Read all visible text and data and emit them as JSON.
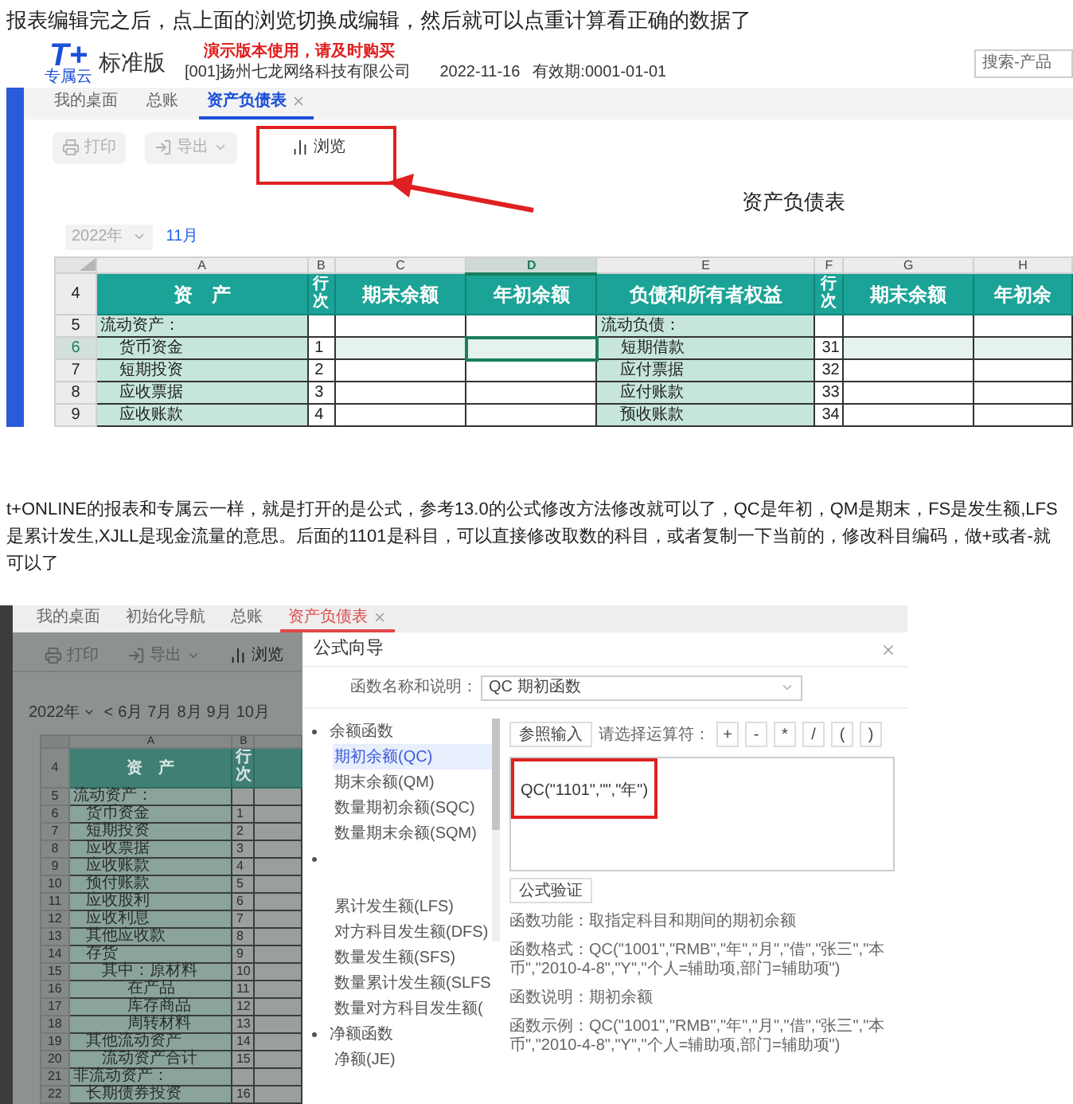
{
  "intro": "报表编辑完之后，点上面的浏览切换成编辑，然后就可以点重计算看正确的数据了",
  "screenshot_1": {
    "logo": {
      "mark": "T+",
      "tagline": "专属云",
      "edition": "标准版"
    },
    "notice": "演示版本使用，请及时购买",
    "company": "[001]扬州七龙网络科技有限公司",
    "date": "2022-11-16",
    "validity": "有效期:0001-01-01",
    "search": {
      "placeholder": "搜索-产品"
    },
    "tabs": [
      {
        "label": "我的桌面",
        "selected": false,
        "closable": false
      },
      {
        "label": "总账",
        "selected": false,
        "closable": false
      },
      {
        "label": "资产负债表",
        "selected": true,
        "closable": true
      }
    ],
    "toolbar": [
      {
        "kind": "print",
        "label": "打印",
        "disabled": true,
        "annotated": false
      },
      {
        "kind": "export",
        "label": "导出",
        "disabled": true,
        "annotated": false
      },
      {
        "kind": "browse",
        "label": "浏览",
        "disabled": false,
        "annotated": true
      }
    ],
    "report_title": "资产负债表",
    "year": "2022年",
    "month": "11月",
    "sheet": {
      "column_letters": [
        {
          "label": "A",
          "selected": false
        },
        {
          "label": "B",
          "selected": false
        },
        {
          "label": "C",
          "selected": false
        },
        {
          "label": "D",
          "selected": true
        },
        {
          "label": "E",
          "selected": false
        },
        {
          "label": "F",
          "selected": false
        },
        {
          "label": "G",
          "selected": false
        },
        {
          "label": "H",
          "selected": false
        }
      ],
      "header_row": {
        "number": "4",
        "cells": [
          "资　产",
          "行次",
          "期末余额",
          "年初余额",
          "负债和所有者权益",
          "行次",
          "期末余额",
          "年初余"
        ]
      },
      "rows": [
        {
          "number": "5",
          "selected": false,
          "asset": {
            "label": "流动资产：",
            "kind": "heading"
          },
          "liability": {
            "label": "流动负债：",
            "kind": "heading"
          }
        },
        {
          "number": "6",
          "selected": true,
          "asset": {
            "label": "货币资金",
            "kind": "item",
            "line": "1"
          },
          "liability": {
            "label": "短期借款",
            "kind": "item",
            "line": "31"
          }
        },
        {
          "number": "7",
          "selected": false,
          "asset": {
            "label": "短期投资",
            "kind": "item",
            "line": "2"
          },
          "liability": {
            "label": "应付票据",
            "kind": "item",
            "line": "32"
          }
        },
        {
          "number": "8",
          "selected": false,
          "asset": {
            "label": "应收票据",
            "kind": "item",
            "line": "3"
          },
          "liability": {
            "label": "应付账款",
            "kind": "item",
            "line": "33"
          }
        },
        {
          "number": "9",
          "selected": false,
          "asset": {
            "label": "应收账款",
            "kind": "item",
            "line": "4"
          },
          "liability": {
            "label": "预收账款",
            "kind": "item",
            "line": "34"
          }
        }
      ]
    }
  },
  "paragraph": "t+ONLINE的报表和专属云一样，就是打开的是公式，参考13.0的公式修改方法修改就可以了，QC是年初，QM是期末，FS是发生额,LFS是累计发生,XJLL是现金流量的意思。后面的1101是科目，可以直接修改取数的科目，或者复制一下当前的，修改科目编码，做+或者-就可以了",
  "screenshot_2": {
    "tabs": [
      {
        "label": "我的桌面",
        "selected": false,
        "closable": false
      },
      {
        "label": "初始化导航",
        "selected": false,
        "closable": false
      },
      {
        "label": "总账",
        "selected": false,
        "closable": false
      },
      {
        "label": "资产负债表",
        "selected": true,
        "closable": true
      }
    ],
    "toolbar": [
      {
        "kind": "print",
        "label": "打印",
        "disabled": true,
        "annotated": false
      },
      {
        "kind": "export",
        "label": "导出",
        "disabled": true,
        "annotated": false
      },
      {
        "kind": "browse",
        "label": "浏览",
        "disabled": false,
        "annotated": false
      }
    ],
    "year": "2022年",
    "prev": "<",
    "months": [
      "6月",
      "7月",
      "8月",
      "9月",
      "10月"
    ],
    "sheet": {
      "column_letters": [
        "A",
        "B"
      ],
      "header_row": {
        "number": "4",
        "cells": [
          "资　产",
          "行次"
        ]
      },
      "rows": [
        {
          "number": "5",
          "label": "流动资产：",
          "kind": "heading"
        },
        {
          "number": "6",
          "label": "货币资金",
          "kind": "item",
          "line": "1"
        },
        {
          "number": "7",
          "label": "短期投资",
          "kind": "item",
          "line": "2"
        },
        {
          "number": "8",
          "label": "应收票据",
          "kind": "item",
          "line": "3"
        },
        {
          "number": "9",
          "label": "应收账款",
          "kind": "item",
          "line": "4"
        },
        {
          "number": "10",
          "label": "预付账款",
          "kind": "item",
          "line": "5"
        },
        {
          "number": "11",
          "label": "应收股利",
          "kind": "item",
          "line": "6"
        },
        {
          "number": "12",
          "label": "应收利息",
          "kind": "item",
          "line": "7"
        },
        {
          "number": "13",
          "label": "其他应收款",
          "kind": "item",
          "line": "8"
        },
        {
          "number": "14",
          "label": "存货",
          "kind": "item",
          "line": "9"
        },
        {
          "number": "15",
          "label": "其中：原材料",
          "kind": "sub",
          "line": "10"
        },
        {
          "number": "16",
          "label": "在产品",
          "kind": "subsub",
          "line": "11"
        },
        {
          "number": "17",
          "label": "库存商品",
          "kind": "subsub",
          "line": "12"
        },
        {
          "number": "18",
          "label": "周转材料",
          "kind": "subsub",
          "line": "13"
        },
        {
          "number": "19",
          "label": "其他流动资产",
          "kind": "item",
          "line": "14"
        },
        {
          "number": "20",
          "label": "流动资产合计",
          "kind": "sub",
          "line": "15"
        },
        {
          "number": "21",
          "label": "非流动资产：",
          "kind": "heading"
        },
        {
          "number": "22",
          "label": "长期债券投资",
          "kind": "item",
          "line": "16"
        }
      ]
    },
    "dialog": {
      "title": "公式向导",
      "function_label": "函数名称和说明：",
      "function_value": "QC 期初函数",
      "tree": [
        {
          "label": "余额函数",
          "children": [
            {
              "label": "期初余额(QC)",
              "selected": true
            },
            {
              "label": "期末余额(QM)",
              "selected": false
            },
            {
              "label": "数量期初余额(SQC)",
              "selected": false
            },
            {
              "label": "数量期末余额(SQM)",
              "selected": false
            }
          ]
        },
        {
          "children": [
            {
              "label": "累计发生额(LFS)",
              "selected": false
            },
            {
              "label": "对方科目发生额(DFS)",
              "selected": false
            },
            {
              "label": "数量发生额(SFS)",
              "selected": false
            },
            {
              "label": "数量累计发生额(SLFS",
              "selected": false
            },
            {
              "label": "数量对方科目发生额(",
              "selected": false
            }
          ]
        },
        {
          "label": "净额函数",
          "children": [
            {
              "label": "净额(JE)",
              "selected": false
            }
          ]
        }
      ],
      "ref_button": "参照输入",
      "operator_label": "请选择运算符：",
      "operators": [
        "+",
        "-",
        "*",
        "/",
        "(",
        ")"
      ],
      "formula": {
        "text": "QC(\"1101\",\"\",\"年\")",
        "annotated": true
      },
      "verify_button": "公式验证",
      "info": [
        "函数功能：取指定科目和期间的期初余额",
        "函数格式：QC(\"1001\",\"RMB\",\"年\",\"月\",\"借\",\"张三\",\"本币\",\"2010-4-8\",\"Y\",\"个人=辅助项,部门=辅助项\")",
        "函数说明：期初余额",
        "函数示例：QC(\"1001\",\"RMB\",\"年\",\"月\",\"借\",\"张三\",\"本币\",\"2010-4-8\",\"Y\",\"个人=辅助项,部门=辅助项\")"
      ]
    }
  }
}
